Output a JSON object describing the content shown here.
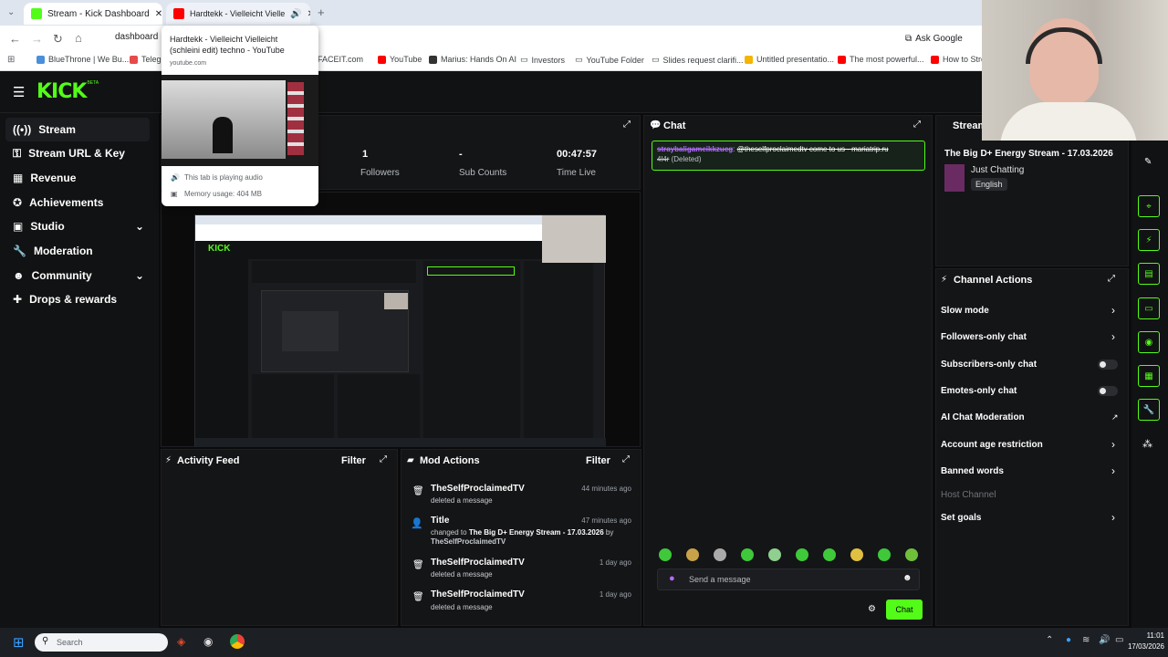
{
  "browser": {
    "tabs": [
      {
        "label": "Stream - Kick Dashboard"
      },
      {
        "label": "Hardtekk - Vielleicht Vielle"
      }
    ],
    "address_partial": "dashboard",
    "ask_google": "Ask Google",
    "bookmarks": [
      "BlueThrone | We Bu...",
      "Telegr",
      "FACEIT.com",
      "YouTube",
      "Marius: Hands On AI",
      "Investors",
      "YouTube Folder",
      "Slides request clarifi...",
      "Untitled presentatio...",
      "The most powerful...",
      "How to Stre"
    ]
  },
  "tab_popup": {
    "title": "Hardtekk - Vielleicht Vielleicht (schleini edit) techno - YouTube",
    "domain": "youtube.com",
    "playing": "This tab is playing audio",
    "memory": "Memory usage: 404 MB"
  },
  "kick": {
    "logo": "KICK",
    "logo_sup": "BETA",
    "sidebar": [
      {
        "label": "Stream",
        "icon": "stream-icon"
      },
      {
        "label": "Stream URL & Key",
        "icon": "key-icon"
      },
      {
        "label": "Revenue",
        "icon": "revenue-icon"
      },
      {
        "label": "Achievements",
        "icon": "trophy-icon"
      },
      {
        "label": "Studio",
        "icon": "studio-icon"
      },
      {
        "label": "Moderation",
        "icon": "wrench-icon"
      },
      {
        "label": "Community",
        "icon": "community-icon"
      },
      {
        "label": "Drops & rewards",
        "icon": "gift-icon"
      }
    ],
    "stats": [
      {
        "value": "1",
        "label": "Followers"
      },
      {
        "value": "-",
        "label": "Sub Counts"
      },
      {
        "value": "00:47:57",
        "label": "Time Live"
      }
    ],
    "chat": {
      "title": "Chat",
      "message_user": "straybaligameikkzucg",
      "message_text": "@theselfproclaimedtv come to us - mariatrip.ru",
      "message_tail": "4l4r",
      "deleted": "(Deleted)",
      "input_placeholder": "Send a message",
      "send_label": "Chat"
    },
    "stream_info": {
      "title": "Stream",
      "stream_title": "The Big D+ Energy Stream - 17.03.2026",
      "category": "Just Chatting",
      "language": "English"
    },
    "channel_actions": {
      "title": "Channel Actions",
      "items": [
        {
          "label": "Slow mode",
          "control": "arrow"
        },
        {
          "label": "Followers-only chat",
          "control": "arrow"
        },
        {
          "label": "Subscribers-only chat",
          "control": "toggle"
        },
        {
          "label": "Emotes-only chat",
          "control": "toggle"
        },
        {
          "label": "AI Chat Moderation",
          "control": "external"
        },
        {
          "label": "Account age restriction",
          "control": "arrow"
        },
        {
          "label": "Banned words",
          "control": "arrow"
        },
        {
          "label": "Host Channel",
          "control": "none"
        },
        {
          "label": "Set goals",
          "control": "arrow"
        }
      ]
    },
    "activity_feed": {
      "title": "Activity Feed",
      "filter": "Filter"
    },
    "mod_actions": {
      "title": "Mod Actions",
      "filter": "Filter",
      "entries": [
        {
          "name": "TheSelfProclaimedTV",
          "detail": "deleted a message",
          "time": "44 minutes ago"
        },
        {
          "name": "Title",
          "detail_prefix": "changed to",
          "detail_bold": "The Big D+ Energy Stream - 17.03.2026",
          "detail_by": "by",
          "detail_user": "TheSelfProclaimedTV",
          "time": "47 minutes ago"
        },
        {
          "name": "TheSelfProclaimedTV",
          "detail": "deleted a message",
          "time": "1 day ago"
        },
        {
          "name": "TheSelfProclaimedTV",
          "detail": "deleted a message",
          "time": "1 day ago"
        }
      ]
    }
  },
  "taskbar": {
    "search_placeholder": "Search",
    "time": "11:01",
    "date": "17/03/2026"
  },
  "colors": {
    "accent": "#53fc18",
    "panel": "#141517",
    "bg": "#0b0b0c"
  }
}
